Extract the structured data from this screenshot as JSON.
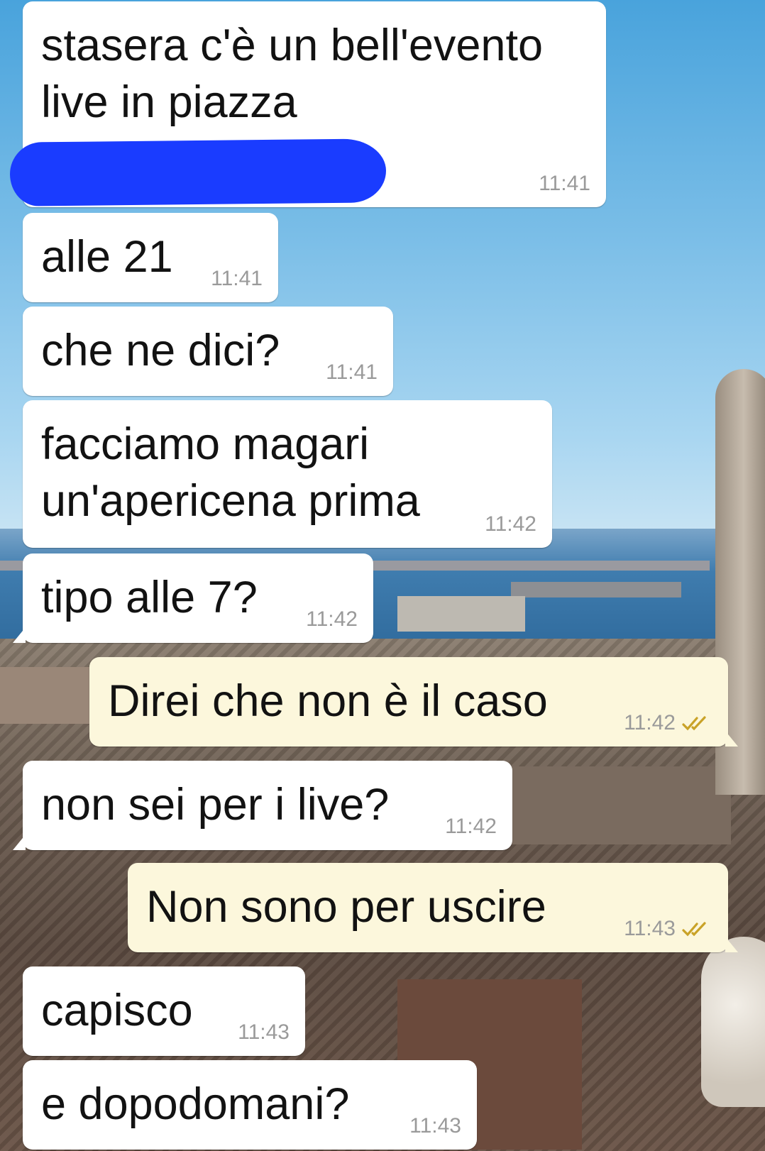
{
  "messages": [
    {
      "direction": "in",
      "text": "stasera c'è un bell'evento live in piazza",
      "time": "11:41"
    },
    {
      "direction": "in",
      "text": "alle 21",
      "time": "11:41"
    },
    {
      "direction": "in",
      "text": "che ne dici?",
      "time": "11:41"
    },
    {
      "direction": "in",
      "text": "facciamo magari un'apericena prima",
      "time": "11:42"
    },
    {
      "direction": "in",
      "text": "tipo alle 7?",
      "time": "11:42"
    },
    {
      "direction": "out",
      "text": "Direi che non è il caso",
      "time": "11:42",
      "status": "read"
    },
    {
      "direction": "in",
      "text": "non sei per i live?",
      "time": "11:42"
    },
    {
      "direction": "out",
      "text": "Non sono per uscire",
      "time": "11:43",
      "status": "read"
    },
    {
      "direction": "in",
      "text": "capisco",
      "time": "11:43"
    },
    {
      "direction": "in",
      "text": "e dopodomani?",
      "time": "11:43"
    }
  ],
  "colors": {
    "incoming_bubble": "#ffffff",
    "outgoing_bubble": "#fcf7dc",
    "timestamp": "#9a9a9a",
    "read_ticks": "#c9a227",
    "redaction": "#1a3cff"
  },
  "icons": {
    "read_receipt": "double-check-icon"
  }
}
